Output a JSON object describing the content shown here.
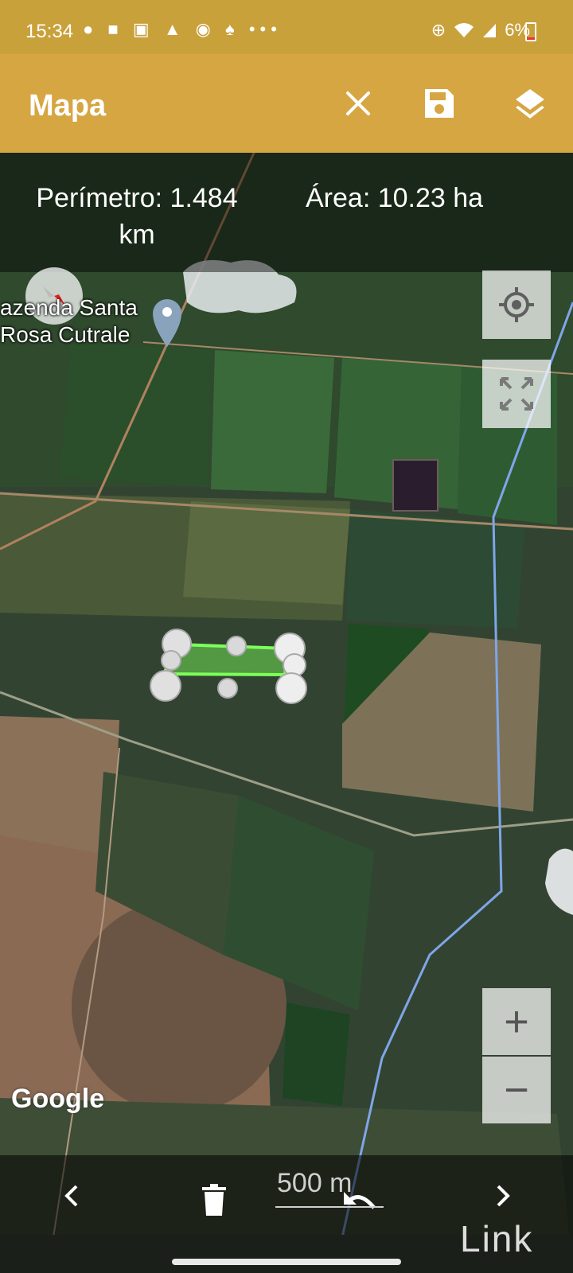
{
  "status_bar": {
    "time": "15:34",
    "icons": [
      "chat-bubble-icon",
      "alert-square-icon",
      "photo-icon",
      "warning-icon",
      "app-icon",
      "flame-icon",
      "more-icon"
    ],
    "more": "•••",
    "battery": "6%",
    "battery_level": 0.06,
    "right_icons": [
      "clock-target-icon",
      "wifi-icon",
      "signal-icon"
    ]
  },
  "app_bar": {
    "title": "Mapa",
    "actions": [
      "close-icon",
      "save-icon",
      "layers-icon"
    ]
  },
  "metrics": {
    "perimeter": "Perímetro: 1.484 km",
    "area": "Área: 10.23 ha"
  },
  "map": {
    "place_label_line1": "azenda Santa",
    "place_label_line2": "Rosa Cutrale",
    "attribution": "Google",
    "scale_label": "500 m",
    "polygon_color": "#7dff5a",
    "route_color": "#7fa6e8",
    "controls": {
      "locate": "crosshair-icon",
      "fullscreen": "expand-icon",
      "zoom_in": "+",
      "zoom_out": "−"
    }
  },
  "bottom_bar": {
    "prev": "chevron-left-icon",
    "delete": "trash-icon",
    "undo": "undo-icon",
    "next": "chevron-right-icon"
  },
  "watermark": "Link"
}
